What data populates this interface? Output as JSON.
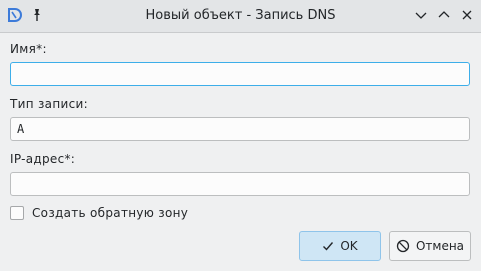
{
  "window": {
    "title": "Новый объект - Запись DNS"
  },
  "form": {
    "name_label": "Имя*:",
    "name_value": "",
    "record_type_label": "Тип записи:",
    "record_type_value": "A",
    "ip_label": "IP-адрес*:",
    "ip_value": "",
    "reverse_zone_label": "Создать обратную зону",
    "reverse_zone_checked": false
  },
  "buttons": {
    "ok": "OK",
    "cancel": "Отмена"
  },
  "colors": {
    "accent": "#3daee9",
    "ok_bg": "#cfe6f5"
  }
}
